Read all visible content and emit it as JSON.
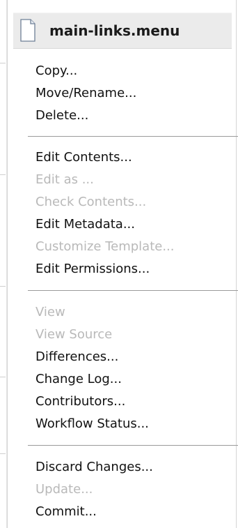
{
  "menu": {
    "title": "main-links.menu",
    "groups": [
      {
        "items": [
          {
            "label": "Copy...",
            "enabled": true
          },
          {
            "label": "Move/Rename...",
            "enabled": true
          },
          {
            "label": "Delete...",
            "enabled": true
          }
        ]
      },
      {
        "items": [
          {
            "label": "Edit Contents...",
            "enabled": true
          },
          {
            "label": "Edit as ...",
            "enabled": false
          },
          {
            "label": "Check Contents...",
            "enabled": false
          },
          {
            "label": "Edit Metadata...",
            "enabled": true
          },
          {
            "label": "Customize Template...",
            "enabled": false
          },
          {
            "label": "Edit Permissions...",
            "enabled": true
          }
        ]
      },
      {
        "items": [
          {
            "label": "View",
            "enabled": false
          },
          {
            "label": "View Source",
            "enabled": false
          },
          {
            "label": "Differences...",
            "enabled": true
          },
          {
            "label": "Change Log...",
            "enabled": true
          },
          {
            "label": "Contributors...",
            "enabled": true
          },
          {
            "label": "Workflow Status...",
            "enabled": true
          }
        ]
      },
      {
        "items": [
          {
            "label": "Discard Changes...",
            "enabled": true
          },
          {
            "label": "Update...",
            "enabled": false
          },
          {
            "label": "Commit...",
            "enabled": true
          }
        ]
      }
    ]
  },
  "colors": {
    "enabled_text": "#111111",
    "disabled_text": "#b9b9b9",
    "header_bg": "#ebebeb",
    "divider": "#9a9a9a"
  },
  "icons": {
    "header": "file-icon"
  }
}
